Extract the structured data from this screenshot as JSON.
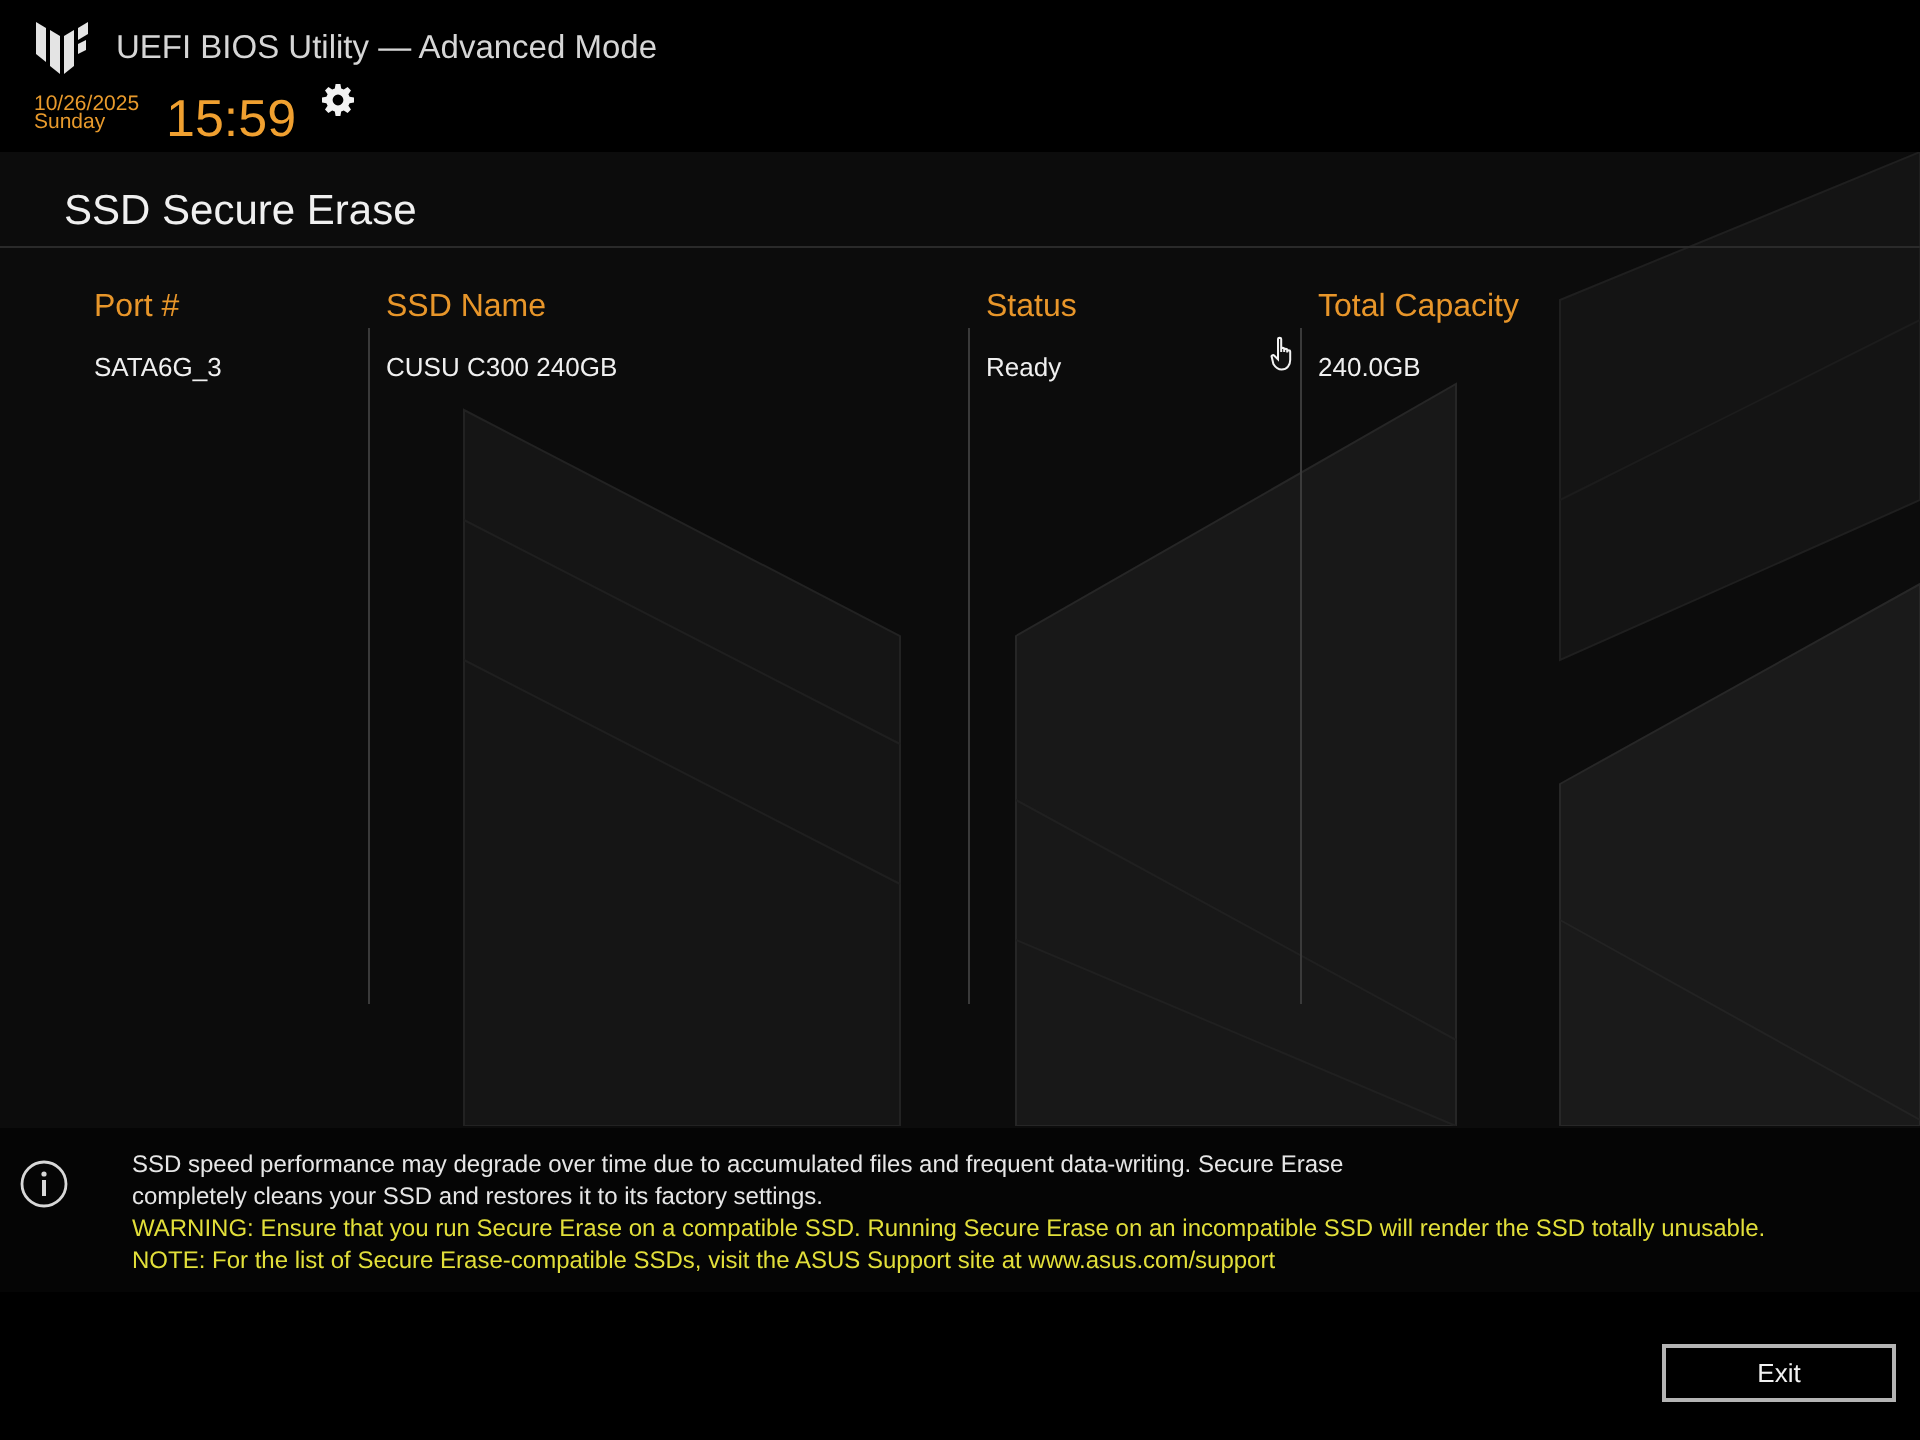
{
  "header": {
    "title": "UEFI BIOS Utility — Advanced Mode",
    "date": "10/26/2025",
    "weekday": "Sunday",
    "time": "15:59"
  },
  "page": {
    "title": "SSD Secure Erase"
  },
  "table": {
    "columns": [
      "Port #",
      "SSD Name",
      "Status",
      "Total Capacity"
    ],
    "rows": [
      {
        "cells": [
          "SATA6G_3",
          "CUSU C300 240GB",
          "Ready",
          "240.0GB"
        ]
      }
    ]
  },
  "info": {
    "lines": [
      {
        "kind": "note",
        "text": "SSD speed performance may degrade over time due to accumulated files and frequent data-writing. Secure Erase\ncompletely cleans your SSD and restores it to its factory settings."
      },
      {
        "kind": "warning",
        "text": "WARNING: Ensure that you run Secure Erase on a compatible SSD. Running Secure Erase on an incompatible SSD will render the SSD totally unusable."
      },
      {
        "kind": "warning",
        "text": "NOTE: For the list of Secure Erase-compatible SSDs, visit the ASUS Support site at www.asus.com/support"
      }
    ]
  },
  "buttons": [
    {
      "label": "Exit"
    }
  ]
}
